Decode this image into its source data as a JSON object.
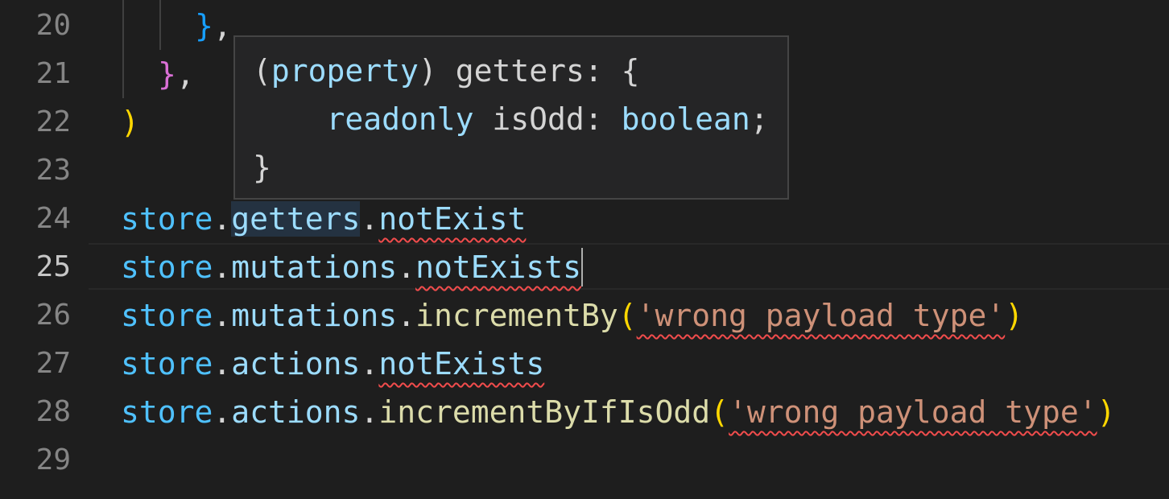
{
  "gutter": {
    "line_numbers": [
      "20",
      "21",
      "22",
      "23",
      "24",
      "25",
      "26",
      "27",
      "28",
      "29"
    ],
    "active_line": "25"
  },
  "code": {
    "line20": {
      "close": "}",
      "comma": ","
    },
    "line21": {
      "close": "}",
      "comma": ","
    },
    "line22": {
      "paren": ")"
    },
    "line24": {
      "obj": "store",
      "dot1": ".",
      "member": "getters",
      "dot2": ".",
      "key": "notExist"
    },
    "line25": {
      "obj": "store",
      "dot1": ".",
      "member": "mutations",
      "dot2": ".",
      "key": "notExists"
    },
    "line26": {
      "obj": "store",
      "dot1": ".",
      "member": "mutations",
      "dot2": ".",
      "fn": "incrementBy",
      "open": "(",
      "arg": "'wrong payload type'",
      "close": ")"
    },
    "line27": {
      "obj": "store",
      "dot1": ".",
      "member": "actions",
      "dot2": ".",
      "key": "notExists"
    },
    "line28": {
      "obj": "store",
      "dot1": ".",
      "member": "actions",
      "dot2": ".",
      "fn": "incrementByIfIsOdd",
      "open": "(",
      "arg": "'wrong payload type'",
      "close": ")"
    }
  },
  "hover": {
    "line1": {
      "open_paren": "(",
      "kind": "property",
      "close_paren": ")",
      "name": " getters: {"
    },
    "line2": {
      "indent": "    ",
      "modifier": "readonly",
      "prop": " isOdd: ",
      "type": "boolean",
      "semi": ";"
    },
    "line3": {
      "close": "}"
    }
  },
  "colors": {
    "background": "#1e1e1e",
    "variable": "#4fc1ff",
    "property": "#9cdcfe",
    "function": "#dcdcaa",
    "string": "#ce9178",
    "error_squiggle": "#f14c4c",
    "bracket_gold": "#ffd700",
    "bracket_orchid": "#da70d6",
    "bracket_blue": "#179fff"
  }
}
